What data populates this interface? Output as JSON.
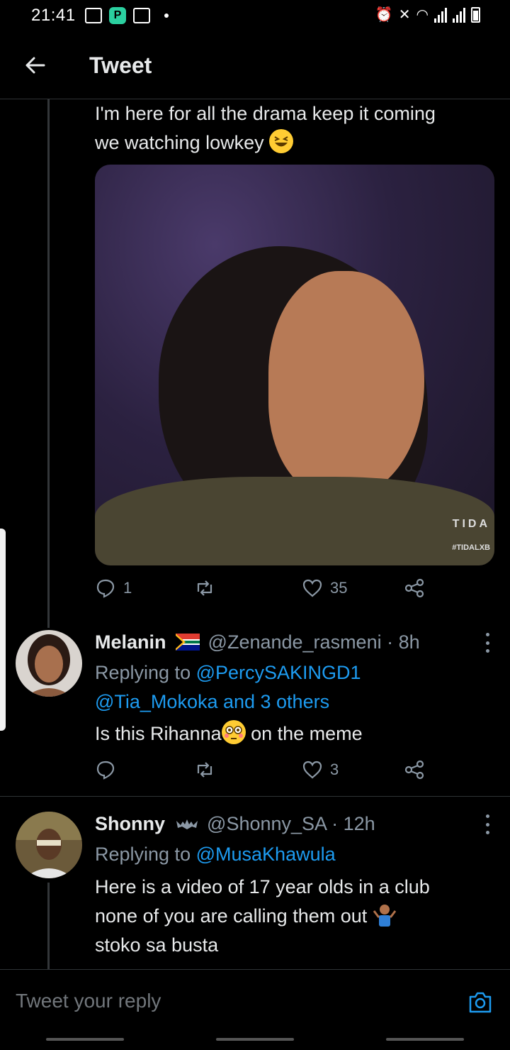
{
  "status_bar": {
    "time": "21:41"
  },
  "header": {
    "title": "Tweet"
  },
  "tweet_main": {
    "text_line1": "I'm here  for all the drama keep it coming",
    "text_line2": "we watching lowkey",
    "media_watermark": "TIDA",
    "media_watermark_tag": "#TIDALXB",
    "replies": "1",
    "likes": "35"
  },
  "reply1": {
    "name": "Melanin",
    "handle": "@Zenande_rasmeni",
    "time": "· 8h",
    "replying_prefix": "Replying to",
    "replying_to_1": "@PercySAKINGD1",
    "replying_to_2": "@Tia_Mokoka and 3 others",
    "text_before": "Is this Rihanna",
    "text_after": " on the meme",
    "likes": "3"
  },
  "reply2": {
    "name": "Shonny",
    "handle": "@Shonny_SA",
    "time": "· 12h",
    "replying_prefix": "Replying to",
    "replying_to": "@MusaKhawula",
    "line1": "Here is a video of 17 year olds in a club",
    "line2": "none of you are calling them out",
    "line3": "stoko sa busta"
  },
  "composer": {
    "placeholder": "Tweet your reply"
  },
  "colors": {
    "accent": "#1d9bf0",
    "background": "#000000",
    "muted": "#8b98a5"
  }
}
